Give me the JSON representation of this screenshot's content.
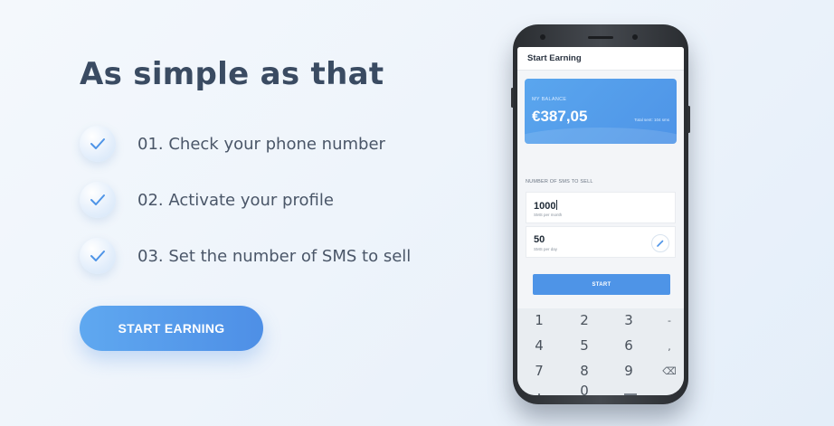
{
  "headline": "As simple as that",
  "steps": [
    {
      "label": "01. Check your phone number"
    },
    {
      "label": "02. Activate your profile"
    },
    {
      "label": "03. Set the number of SMS to sell"
    }
  ],
  "cta": {
    "label": "START EARNING"
  },
  "colors": {
    "accent": "#4e94e7",
    "headline": "#3a4b62",
    "check": "#4e94e7"
  },
  "phone": {
    "app_title": "Start Earning",
    "balance": {
      "label": "MY BALANCE",
      "amount": "€387,05",
      "note": "Total sent: 104 sms"
    },
    "sms_section_label": "NUMBER OF SMS TO SELL",
    "fields": {
      "per_month": {
        "value": "1000",
        "sublabel": "SMS per month"
      },
      "per_day": {
        "value": "50",
        "sublabel": "SMS per day"
      }
    },
    "start_button": "START",
    "keypad": {
      "row1": [
        "1",
        "2",
        "3",
        "-"
      ],
      "row2": [
        "4",
        "5",
        "6",
        ","
      ],
      "row3": [
        "7",
        "8",
        "9",
        "⌫"
      ],
      "row4": [
        ".",
        "0"
      ]
    }
  }
}
